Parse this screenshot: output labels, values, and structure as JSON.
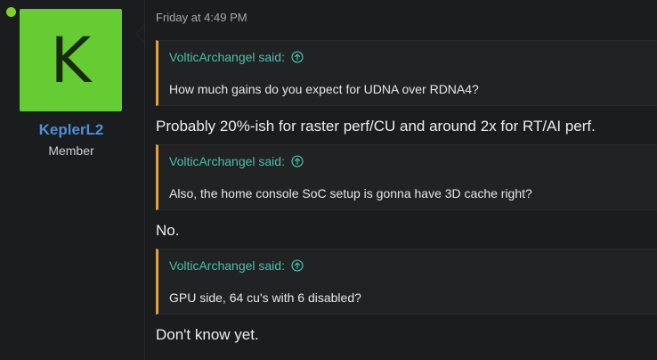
{
  "author": {
    "avatar_letter": "K",
    "avatar_color": "#66cc33",
    "online_color": "#7ed321",
    "username": "KeplerL2",
    "title": "Member"
  },
  "post": {
    "date": "Friday at 4:49 PM",
    "blocks": [
      {
        "quote_author": "VolticArchangel said:",
        "quote_text": "How much gains do you expect for UDNA over RDNA4?",
        "reply": "Probably 20%-ish for raster perf/CU and around 2x for RT/AI perf."
      },
      {
        "quote_author": "VolticArchangel said:",
        "quote_text": "Also, the home console SoC setup is gonna have 3D cache right?",
        "reply": "No."
      },
      {
        "quote_author": "VolticArchangel said:",
        "quote_text": "GPU side, 64 cu's with 6 disabled?",
        "reply": "Don't know yet."
      }
    ]
  },
  "icons": {
    "quote_jump": "arrow-up-circle-icon"
  },
  "colors": {
    "background": "#1b1c1e",
    "quote_bg": "#212224",
    "quote_border": "#e3a042",
    "quote_author": "#47c1a8",
    "username": "#4d8fd6"
  }
}
